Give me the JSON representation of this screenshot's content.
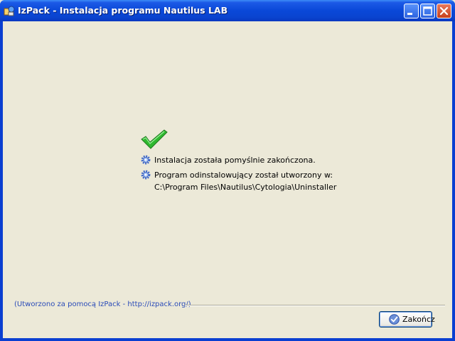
{
  "window": {
    "title": "IzPack - Instalacja programu Nautilus LAB",
    "icons": {
      "app": "izpack-app-icon",
      "minimize": "minimize-icon",
      "maximize": "maximize-icon",
      "close": "close-icon"
    }
  },
  "content": {
    "status_icon": "green-checkmark-icon",
    "messages": [
      {
        "icon": "gear-icon",
        "lines": [
          "Instalacja została pomyślnie zakończona."
        ]
      },
      {
        "icon": "gear-icon",
        "lines": [
          "Program odinstalowujący został utworzony w:",
          "C:\\Program Files\\Nautilus\\Cytologia\\Uninstaller"
        ]
      }
    ]
  },
  "footer": {
    "credit": "(Utworzono za pomocą IzPack - http://izpack.org/)",
    "finish_label": "Zakończ",
    "finish_icon": "checkmark-circle-icon"
  },
  "colors": {
    "title_bar": "#0a48d8",
    "client_bg": "#ece9d8",
    "credit_text": "#2a4bb8",
    "check_green": "#2fb82f"
  }
}
